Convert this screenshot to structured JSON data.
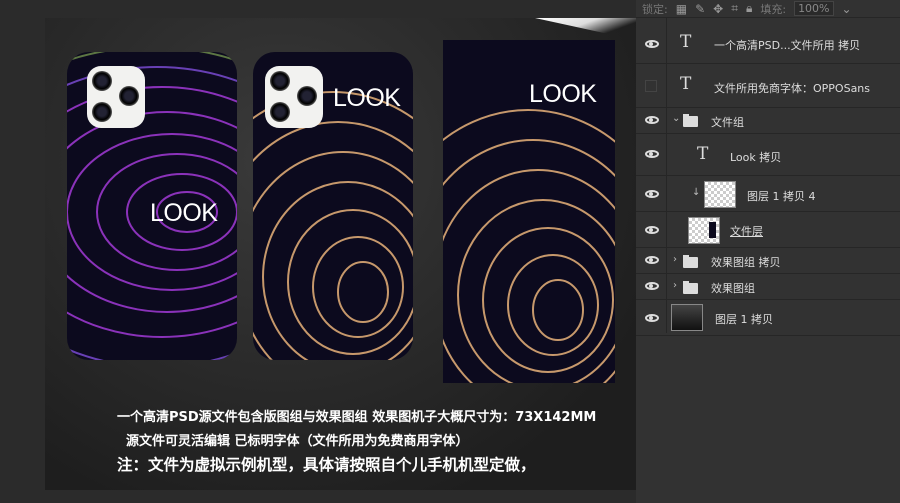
{
  "layers_panel": {
    "lock_label": "锁定:",
    "fill_label": "填充:",
    "fill_value": "100%",
    "layers": [
      {
        "name": "一个高清PSD...文件所用 拷贝",
        "type": "text",
        "visible": true
      },
      {
        "name": "文件所用免商字体：OPPOSans",
        "type": "text",
        "visible": false
      },
      {
        "name": "文件组",
        "type": "group",
        "expanded": true,
        "visible": true
      },
      {
        "name": "Look 拷贝",
        "type": "text",
        "visible": true
      },
      {
        "name": "图层 1 拷贝 4",
        "type": "clipped-image",
        "visible": true
      },
      {
        "name": "文件层",
        "type": "image",
        "visible": true
      },
      {
        "name": "效果图组 拷贝",
        "type": "group",
        "expanded": false,
        "visible": true
      },
      {
        "name": "效果图组",
        "type": "group",
        "expanded": false,
        "visible": true
      },
      {
        "name": "图层 1 拷贝",
        "type": "image",
        "visible": true
      }
    ]
  },
  "canvas": {
    "phone1_text": "LOOK",
    "phone2_text": "LOOK",
    "phone3_text": "LOOK",
    "caption_line1": "一个高清PSD源文件包含版图组与效果图组  效果图机子大概尺寸为：73X142MM",
    "caption_line2": "源文件可灵活编辑 已标明字体（文件所用为免费商用字体）",
    "caption_line3": "注：文件为虚拟示例机型，具体请按照自个儿手机机型定做，"
  },
  "colors": {
    "purple": "#a23ad6",
    "gold": "#e8b27a",
    "phone_bg": "#0c0a1e",
    "panel_bg": "#323232"
  }
}
